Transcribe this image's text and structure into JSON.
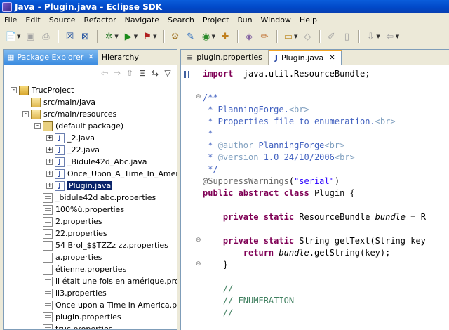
{
  "window": {
    "title": "Java - Plugin.java - Eclipse SDK"
  },
  "menu": [
    "File",
    "Edit",
    "Source",
    "Refactor",
    "Navigate",
    "Search",
    "Project",
    "Run",
    "Window",
    "Help"
  ],
  "package_explorer": {
    "tab_label": "Package Explorer",
    "other_tab": "Hierarchy",
    "tree": [
      {
        "label": "TrucProject",
        "icon": "project-icon",
        "level": 0,
        "exp": "-"
      },
      {
        "label": "src/main/java",
        "icon": "source-folder-icon",
        "level": 1,
        "exp": ""
      },
      {
        "label": "src/main/resources",
        "icon": "source-folder-icon",
        "level": 1,
        "exp": "-"
      },
      {
        "label": "(default package)",
        "icon": "package-icon",
        "level": 2,
        "exp": "-"
      },
      {
        "label": "_2.java",
        "icon": "java-file-icon",
        "level": 3,
        "exp": "+"
      },
      {
        "label": "_22.java",
        "icon": "java-file-icon",
        "level": 3,
        "exp": "+"
      },
      {
        "label": "_Bidule42d_Abc.java",
        "icon": "java-file-icon",
        "level": 3,
        "exp": "+"
      },
      {
        "label": "Once_Upon_A_Time_In_Ameri",
        "icon": "java-file-icon",
        "level": 3,
        "exp": "+"
      },
      {
        "label": "Plugin.java",
        "icon": "java-file-icon",
        "level": 3,
        "exp": "+",
        "selected": true
      },
      {
        "label": "_bidule42d abc.properties",
        "icon": "text-file-icon",
        "level": 2,
        "exp": ""
      },
      {
        "label": "100%ù.properties",
        "icon": "text-file-icon",
        "level": 2,
        "exp": ""
      },
      {
        "label": "2.properties",
        "icon": "text-file-icon",
        "level": 2,
        "exp": ""
      },
      {
        "label": "22.properties",
        "icon": "text-file-icon",
        "level": 2,
        "exp": ""
      },
      {
        "label": "54 Brol_$$TZZz zz.properties",
        "icon": "text-file-icon",
        "level": 2,
        "exp": ""
      },
      {
        "label": "a.properties",
        "icon": "text-file-icon",
        "level": 2,
        "exp": ""
      },
      {
        "label": "étienne.properties",
        "icon": "text-file-icon",
        "level": 2,
        "exp": ""
      },
      {
        "label": "il était une fois en amérique.prope",
        "icon": "text-file-icon",
        "level": 2,
        "exp": ""
      },
      {
        "label": "li3.properties",
        "icon": "text-file-icon",
        "level": 2,
        "exp": ""
      },
      {
        "label": "Once upon a Time in America.prop",
        "icon": "text-file-icon",
        "level": 2,
        "exp": ""
      },
      {
        "label": "plugin.properties",
        "icon": "text-file-icon",
        "level": 2,
        "exp": ""
      },
      {
        "label": "truc.properties",
        "icon": "text-file-icon",
        "level": 2,
        "exp": ""
      }
    ]
  },
  "editor": {
    "tabs": [
      {
        "label": "plugin.properties",
        "active": false
      },
      {
        "label": "Plugin.java",
        "active": true
      }
    ],
    "lines": [
      [
        [
          "kw",
          "import"
        ],
        [
          "",
          "  java.util.ResourceBundle;"
        ]
      ],
      [],
      [
        [
          "cm",
          "/**"
        ]
      ],
      [
        [
          "cm",
          " * PlanningForge."
        ],
        [
          "ct",
          "<br>"
        ]
      ],
      [
        [
          "cm",
          " * Properties file to enumeration."
        ],
        [
          "ct",
          "<br>"
        ]
      ],
      [
        [
          "cm",
          " *"
        ]
      ],
      [
        [
          "cm",
          " * "
        ],
        [
          "ct",
          "@author"
        ],
        [
          "cm",
          " PlanningForge"
        ],
        [
          "ct",
          "<br>"
        ]
      ],
      [
        [
          "cm",
          " * "
        ],
        [
          "ct",
          "@version"
        ],
        [
          "cm",
          " 1.0 24/10/2006"
        ],
        [
          "ct",
          "<br>"
        ]
      ],
      [
        [
          "cm",
          " */"
        ]
      ],
      [
        [
          "an",
          "@SuppressWarnings"
        ],
        [
          "",
          "("
        ],
        [
          "st",
          "\"serial\""
        ],
        [
          "",
          ")"
        ]
      ],
      [
        [
          "kw",
          "public abstract class"
        ],
        [
          "",
          " Plugin {"
        ]
      ],
      [],
      [
        [
          "",
          "    "
        ],
        [
          "kw",
          "private static"
        ],
        [
          "",
          " ResourceBundle "
        ],
        [
          "it",
          "bundle"
        ],
        [
          "",
          " = R"
        ]
      ],
      [],
      [
        [
          "",
          "    "
        ],
        [
          "kw",
          "private static"
        ],
        [
          "",
          " String getText(String key"
        ]
      ],
      [
        [
          "",
          "        "
        ],
        [
          "kw",
          "return"
        ],
        [
          "",
          " "
        ],
        [
          "it",
          "bundle"
        ],
        [
          "",
          ".getString(key);"
        ]
      ],
      [
        [
          "",
          "    }"
        ]
      ],
      [],
      [
        [
          "lc",
          "    //"
        ]
      ],
      [
        [
          "lc",
          "    // ENUMERATION"
        ]
      ],
      [
        [
          "lc",
          "    //"
        ]
      ]
    ]
  }
}
